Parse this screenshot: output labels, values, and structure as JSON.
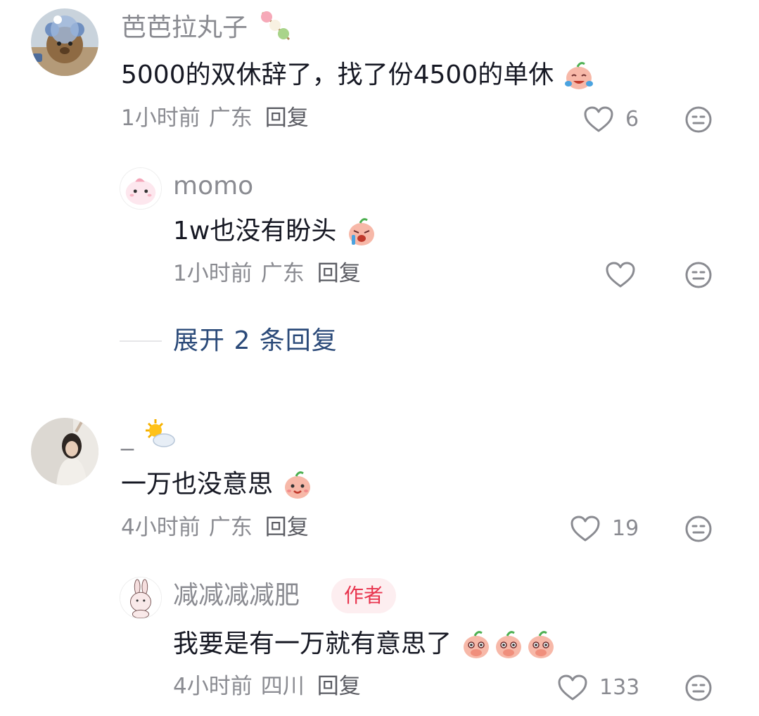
{
  "comments": [
    {
      "username": "芭芭拉丸子",
      "text": "5000的双休辞了，找了份4500的单休",
      "time": "1小时前",
      "location": "广东",
      "reply_label": "回复",
      "likes": "6",
      "replies": [
        {
          "username": "momo",
          "text": "1w也没有盼头",
          "time": "1小时前",
          "location": "广东",
          "reply_label": "回复",
          "likes": ""
        }
      ],
      "expand_label": "展开 2 条回复"
    },
    {
      "username": "_",
      "text": "一万也没意思",
      "time": "4小时前",
      "location": "广东",
      "reply_label": "回复",
      "likes": "19",
      "replies": [
        {
          "username": "减减减减肥",
          "badge": "作者",
          "text": "我要是有一万就有意思了",
          "time": "4小时前",
          "location": "四川",
          "reply_label": "回复",
          "likes": "133"
        }
      ]
    }
  ],
  "icons": {
    "like": "heart-outline-icon",
    "dislike": "neutral-face-icon"
  },
  "colors": {
    "secondary_text": "#8a8b91",
    "link_blue": "#2b4a79",
    "author_badge_bg": "#fdeef0",
    "author_badge_text": "#e8344e"
  }
}
